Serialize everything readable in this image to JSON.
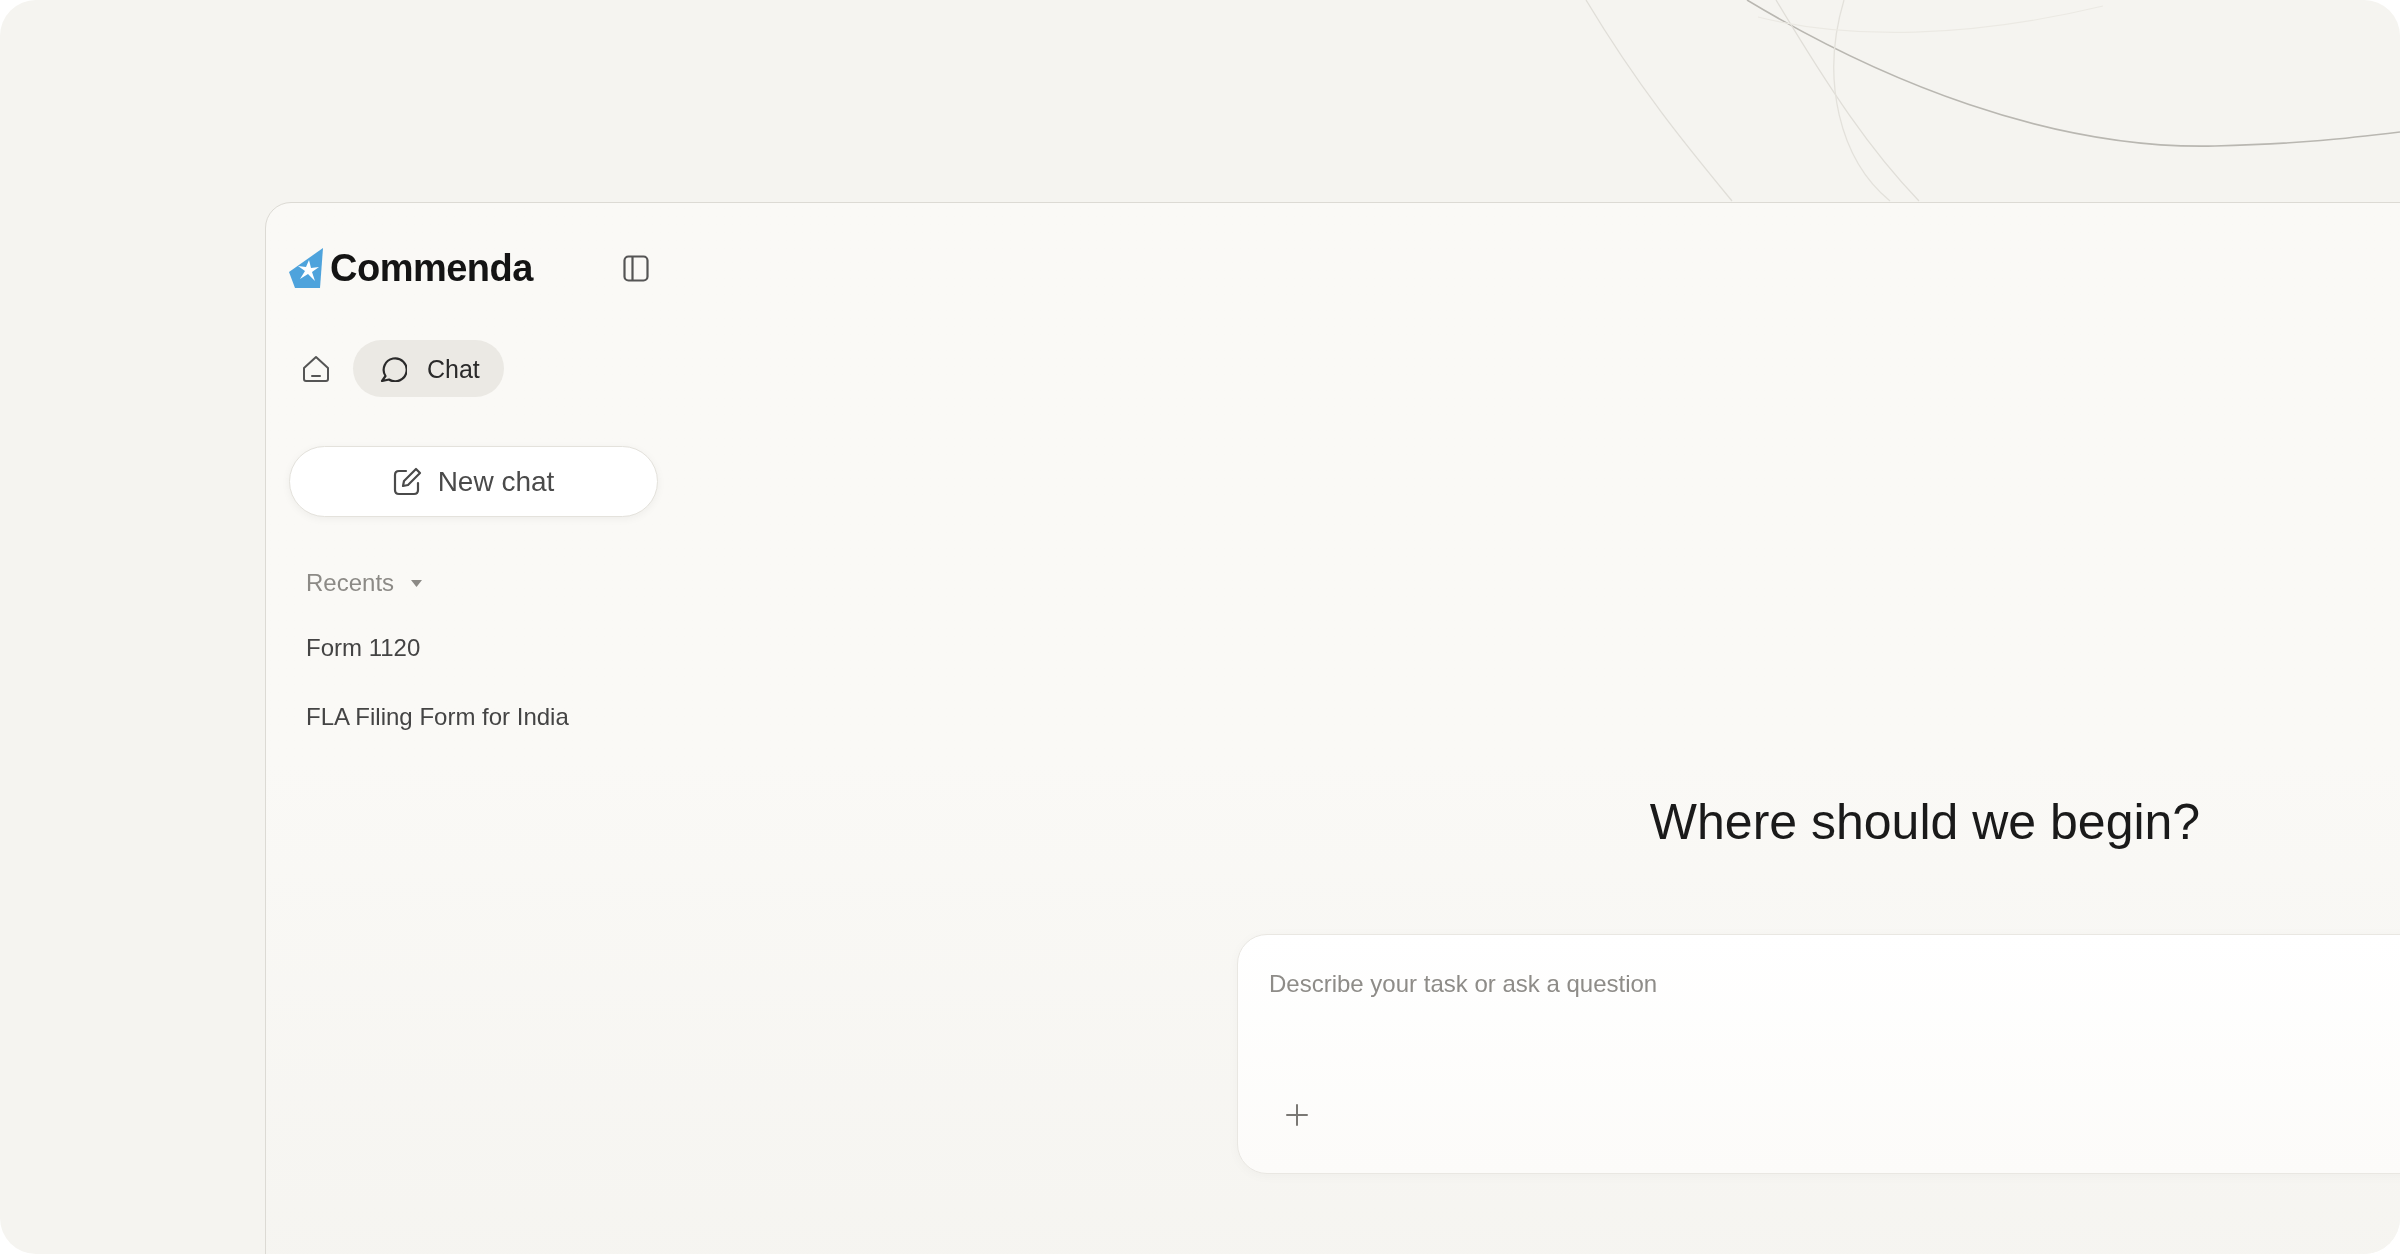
{
  "brand": {
    "name": "Commenda"
  },
  "nav_tabs": [
    {
      "kind": "home",
      "selected": false
    },
    {
      "kind": "chat",
      "label": "Chat",
      "selected": true
    }
  ],
  "new_chat_button": {
    "label": "New chat"
  },
  "recents": {
    "label": "Recents",
    "expanded": true,
    "items": [
      {
        "label": "Form 1120",
        "selected": false
      },
      {
        "label": "FLA Filing Form for India",
        "selected": false
      }
    ]
  },
  "main": {
    "heading": "Where should we begin?",
    "composer": {
      "placeholder": "Describe your task or ask a question"
    }
  }
}
